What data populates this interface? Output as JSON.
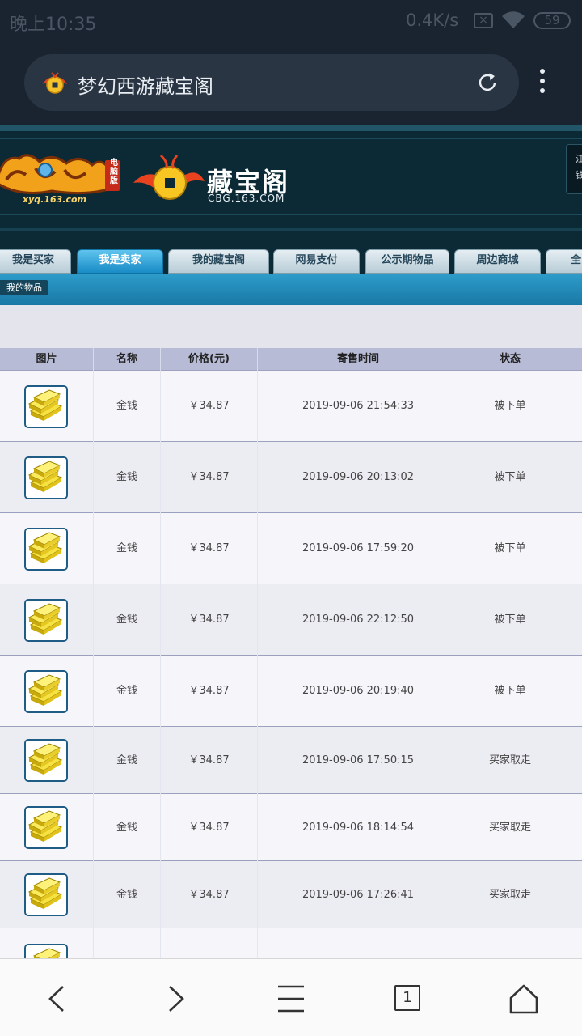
{
  "status_bar": {
    "time": "晚上10:35",
    "net_speed": "0.4K/s",
    "battery": "59"
  },
  "browser": {
    "page_title": "梦幻西游藏宝阁"
  },
  "banner": {
    "game_sub": "xyq.163.com",
    "game_badge": "电脑版",
    "site_title": "藏宝阁",
    "site_url": "CBG.163.COM",
    "side_text_1": "江",
    "side_text_2": "钱"
  },
  "tabs": [
    {
      "label": "我是买家"
    },
    {
      "label": "我是卖家"
    },
    {
      "label": "我的藏宝阁"
    },
    {
      "label": "网易支付"
    },
    {
      "label": "公示期物品"
    },
    {
      "label": "周边商城"
    },
    {
      "label": "全"
    }
  ],
  "active_tab": "我是卖家",
  "subnav": {
    "label": "我的物品"
  },
  "table": {
    "headers": [
      "图片",
      "名称",
      "价格(元)",
      "寄售时间",
      "状态"
    ],
    "rows": [
      {
        "name": "金钱",
        "price": "￥34.87",
        "time": "2019-09-06 21:54:33",
        "status": "被下单"
      },
      {
        "name": "金钱",
        "price": "￥34.87",
        "time": "2019-09-06 20:13:02",
        "status": "被下单"
      },
      {
        "name": "金钱",
        "price": "￥34.87",
        "time": "2019-09-06 17:59:20",
        "status": "被下单"
      },
      {
        "name": "金钱",
        "price": "￥34.87",
        "time": "2019-09-06 22:12:50",
        "status": "被下单"
      },
      {
        "name": "金钱",
        "price": "￥34.87",
        "time": "2019-09-06 20:19:40",
        "status": "被下单"
      },
      {
        "name": "金钱",
        "price": "￥34.87",
        "time": "2019-09-06 17:50:15",
        "status": "买家取走"
      },
      {
        "name": "金钱",
        "price": "￥34.87",
        "time": "2019-09-06 18:14:54",
        "status": "买家取走"
      },
      {
        "name": "金钱",
        "price": "￥34.87",
        "time": "2019-09-06 17:26:41",
        "status": "买家取走"
      }
    ]
  },
  "bottom_nav": {
    "tab_count": "1",
    "icons": [
      "back-icon",
      "forward-icon",
      "menu-icon",
      "tabs-icon",
      "home-icon"
    ]
  }
}
